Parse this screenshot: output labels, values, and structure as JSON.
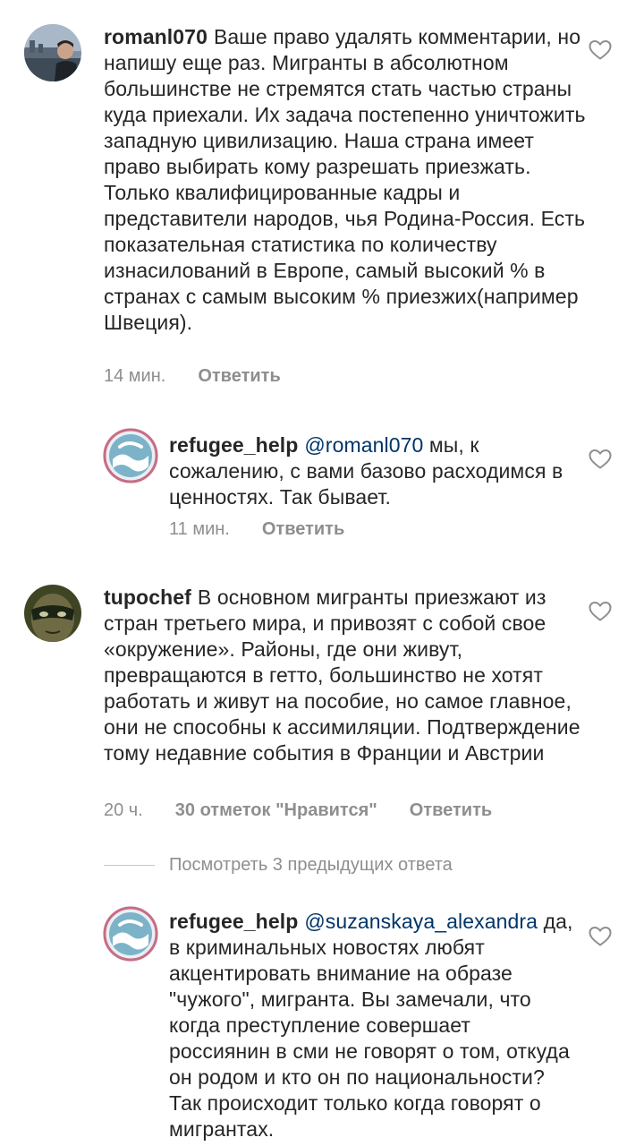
{
  "comments": [
    {
      "username": "romanl070",
      "text": "Ваше право удалять комментарии, но напишу еще раз. Мигранты в абсолютном большинстве не стремятся стать частью страны куда приехали. Их задача постепенно уничтожить западную цивилизацию. Наша страна имеет право выбирать кому разрешать приезжать. Только квалифицированные кадры и представители народов, чья Родина-Россия. Есть показательная статистика по количеству изнасилований в  Европе, самый высокий % в странах с самым высоким % приезжих(например  Швеция).",
      "time": "14 мин.",
      "reply_label": "Ответить",
      "avatar": "city-photo-avatar"
    },
    {
      "username": "refugee_help",
      "mention": "@romanl070",
      "text": "мы, к сожалению, с вами базово расходимся в ценностях. Так бывает.",
      "time": "11 мин.",
      "reply_label": "Ответить",
      "avatar": "refugee-help-logo"
    },
    {
      "username": "tupochef",
      "text": "В основном мигранты приезжают из стран третьего мира, и привозят с собой свое «окружение». Районы, где они живут, превращаются в гетто, большинство не хотят работать и живут на пособие, но самое главное, они не способны к ассимиляции. Подтверждение тому недавние события в Франции и Австрии",
      "time": "20 ч.",
      "likes": "30 отметок \"Нравится\"",
      "reply_label": "Ответить",
      "avatar": "masked-face-avatar"
    },
    {
      "username": "refugee_help",
      "mention": "@suzanskaya_alexandra",
      "text": "да, в криминальных новостях любят акцентировать внимание на образе \"чужого\", мигранта. Вы замечали, что когда преступление совершает россиянин в сми не говорят о том, откуда он родом и кто он по национальности? Так происходит только когда говорят о мигрантах.",
      "avatar": "refugee-help-logo"
    }
  ],
  "view_replies_label": "Посмотреть 3 предыдущих ответа",
  "colors": {
    "text": "#262626",
    "meta": "#8e8e8e",
    "mention": "#003569",
    "heart": "#8e8e8e"
  },
  "icons": [
    "heart-icon"
  ]
}
